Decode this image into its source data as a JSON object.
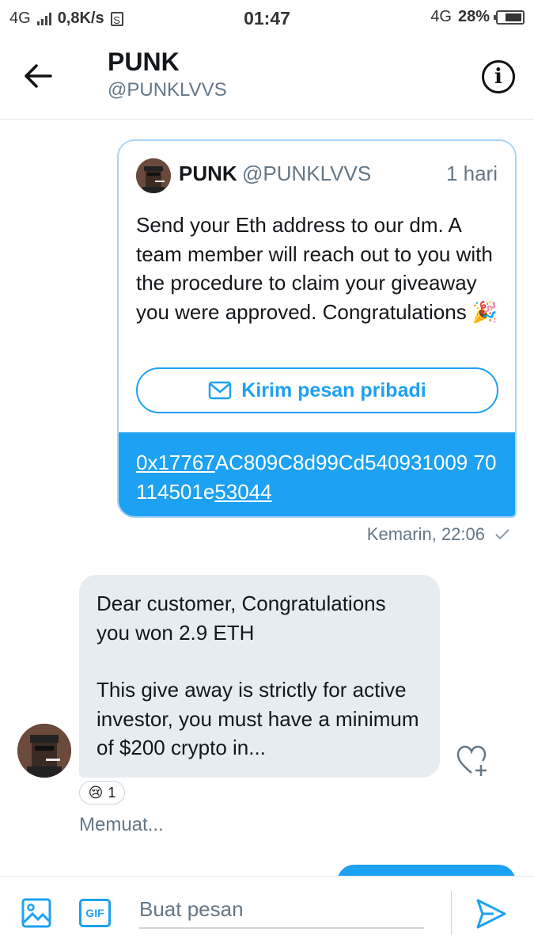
{
  "status_bar": {
    "network_left": "4G",
    "speed": "0,8K/s",
    "time": "01:47",
    "network_right": "4G",
    "battery": "28%"
  },
  "header": {
    "title": "PUNK",
    "handle": "@PUNKLVVS"
  },
  "sent_message": {
    "quoted_tweet": {
      "name": "PUNK",
      "handle": "@PUNKLVVS",
      "time": "1 hari",
      "text": "Send your Eth address to our dm. A team member will reach out to you with the procedure to claim your giveaway you were approved. Congratulations 🎉",
      "dm_button_label": "Kirim pesan pribadi"
    },
    "text_part1": "0x17767",
    "text_part2": "AC809C8d99Cd540931009 70114501e",
    "text_part3": "53044",
    "timestamp": "Kemarin, 22:06",
    "status_icon": "check-icon"
  },
  "received_message": {
    "paragraph1": "Dear customer, Congratulations you won 2.9 ETH",
    "paragraph2": "This give away is strictly for active investor, you must have a minimum of $200 crypto in...",
    "reaction_emoji": "😢",
    "reaction_count": "1",
    "loading_text": "Memuat..."
  },
  "composer": {
    "placeholder": "Buat pesan",
    "gif_label": "GIF"
  },
  "colors": {
    "accent": "#1da1f2",
    "received_bubble": "#e6ecf0",
    "secondary_text": "#657786"
  }
}
